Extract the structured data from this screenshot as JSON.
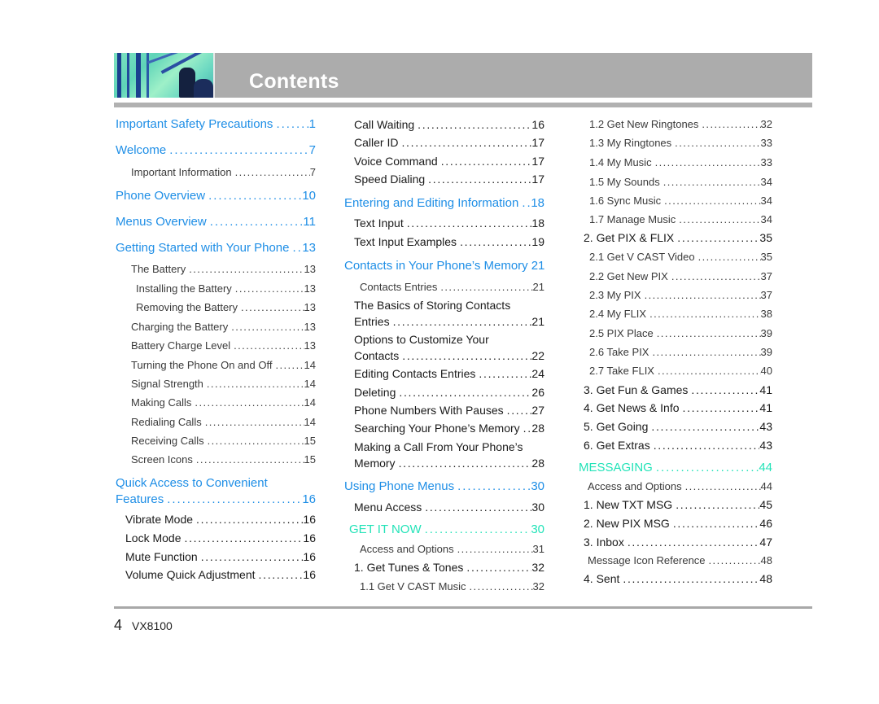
{
  "header": {
    "title": "Contents",
    "image_icon": "header-photo"
  },
  "colors": {
    "section": "#1e8ee6",
    "teal": "#23e3b8",
    "main": "#1a1a1a",
    "sub": "#3a3a3a",
    "header_bg": "#acacac"
  },
  "col1": [
    {
      "text": "Important Safety Precautions",
      "page": "1",
      "level": "section"
    },
    {
      "text": "Welcome",
      "page": "7",
      "level": "section"
    },
    {
      "text": "Important Information",
      "page": "7",
      "level": "sub"
    },
    {
      "text": "Phone Overview",
      "page": "10",
      "level": "section"
    },
    {
      "text": "Menus Overview",
      "page": "11",
      "level": "section"
    },
    {
      "text": "Getting Started with Your Phone",
      "page": "13",
      "level": "section"
    },
    {
      "text": "The Battery",
      "page": "13",
      "level": "sub"
    },
    {
      "text": "Installing the Battery",
      "page": "13",
      "level": "sub"
    },
    {
      "text": "Removing the Battery",
      "page": "13",
      "level": "sub"
    },
    {
      "text": "Charging the Battery",
      "page": "13",
      "level": "sub"
    },
    {
      "text": "Battery Charge Level",
      "page": "13",
      "level": "sub"
    },
    {
      "text": "Turning the Phone On and Off",
      "page": "14",
      "level": "sub"
    },
    {
      "text": "Signal Strength",
      "page": "14",
      "level": "sub"
    },
    {
      "text": "Making Calls",
      "page": "14",
      "level": "sub"
    },
    {
      "text": "Redialing Calls",
      "page": "14",
      "level": "sub"
    },
    {
      "text": "Receiving Calls",
      "page": "15",
      "level": "sub"
    },
    {
      "text": "Screen Icons",
      "page": "15",
      "level": "sub"
    },
    {
      "text_line1": "Quick Access to Convenient",
      "text": "Features",
      "page": "16",
      "level": "section"
    },
    {
      "text": "Vibrate Mode",
      "page": "16",
      "level": "main"
    },
    {
      "text": "Lock Mode",
      "page": "16",
      "level": "main"
    },
    {
      "text": "Mute Function",
      "page": "16",
      "level": "main"
    },
    {
      "text": "Volume Quick Adjustment",
      "page": "16",
      "level": "main"
    }
  ],
  "col2": [
    {
      "text": "Call Waiting",
      "page": "16",
      "level": "main"
    },
    {
      "text": "Caller ID",
      "page": "17",
      "level": "main"
    },
    {
      "text": "Voice Command",
      "page": "17",
      "level": "main"
    },
    {
      "text": "Speed Dialing",
      "page": "17",
      "level": "main"
    },
    {
      "text": "Entering and Editing Information",
      "page": "18",
      "level": "section"
    },
    {
      "text": "Text Input",
      "page": "18",
      "level": "main"
    },
    {
      "text": "Text Input Examples",
      "page": "19",
      "level": "main"
    },
    {
      "text": "Contacts in Your Phone’s Memory",
      "page": "21",
      "level": "section"
    },
    {
      "text": "Contacts Entries",
      "page": "21",
      "level": "sub"
    },
    {
      "text_line1": "The Basics of Storing Contacts",
      "text": "Entries",
      "page": "21",
      "level": "main"
    },
    {
      "text_line1": "Options to Customize Your",
      "text": "Contacts",
      "page": "22",
      "level": "main"
    },
    {
      "text": "Editing Contacts Entries",
      "page": "24",
      "level": "main"
    },
    {
      "text": "Deleting",
      "page": "26",
      "level": "main"
    },
    {
      "text": "Phone Numbers With Pauses",
      "page": "27",
      "level": "main"
    },
    {
      "text": "Searching Your Phone’s Memory",
      "page": "28",
      "level": "main"
    },
    {
      "text_line1": "Making a Call From Your Phone’s",
      "text": "Memory",
      "page": "28",
      "level": "main"
    },
    {
      "text": "Using Phone Menus",
      "page": "30",
      "level": "section"
    },
    {
      "text": "Menu Access",
      "page": "30",
      "level": "main"
    },
    {
      "text": "GET IT NOW",
      "page": "30",
      "level": "teal"
    },
    {
      "text": "Access and Options",
      "page": "31",
      "level": "sub"
    },
    {
      "text": "1. Get Tunes & Tones",
      "page": "32",
      "level": "main"
    },
    {
      "text": "1.1 Get V CAST Music",
      "page": "32",
      "level": "sub"
    }
  ],
  "col3": [
    {
      "text": "1.2 Get New Ringtones",
      "page": "32",
      "level": "sub"
    },
    {
      "text": "1.3 My Ringtones",
      "page": "33",
      "level": "sub"
    },
    {
      "text": "1.4 My Music",
      "page": "33",
      "level": "sub"
    },
    {
      "text": "1.5 My Sounds",
      "page": "34",
      "level": "sub"
    },
    {
      "text": "1.6 Sync Music",
      "page": "34",
      "level": "sub"
    },
    {
      "text": "1.7 Manage Music",
      "page": "34",
      "level": "sub"
    },
    {
      "text": "2. Get PIX & FLIX",
      "page": "35",
      "level": "main"
    },
    {
      "text": "2.1 Get V CAST Video",
      "page": "35",
      "level": "sub"
    },
    {
      "text": "2.2 Get New PIX",
      "page": "37",
      "level": "sub"
    },
    {
      "text": "2.3 My PIX",
      "page": "37",
      "level": "sub"
    },
    {
      "text": "2.4 My FLIX",
      "page": "38",
      "level": "sub"
    },
    {
      "text": "2.5 PIX Place",
      "page": "39",
      "level": "sub"
    },
    {
      "text": "2.6 Take PIX",
      "page": "39",
      "level": "sub"
    },
    {
      "text": "2.7 Take FLIX",
      "page": "40",
      "level": "sub"
    },
    {
      "text": "3. Get Fun & Games",
      "page": "41",
      "level": "main"
    },
    {
      "text": "4. Get News & Info",
      "page": "41",
      "level": "main"
    },
    {
      "text": "5. Get Going",
      "page": "43",
      "level": "main"
    },
    {
      "text": "6. Get Extras",
      "page": "43",
      "level": "main"
    },
    {
      "text": "MESSAGING",
      "page": "44",
      "level": "teal"
    },
    {
      "text": "Access and Options",
      "page": "44",
      "level": "sub"
    },
    {
      "text": "1. New TXT MSG",
      "page": "45",
      "level": "main"
    },
    {
      "text": "2. New PIX MSG",
      "page": "46",
      "level": "main"
    },
    {
      "text": "3. Inbox",
      "page": "47",
      "level": "main"
    },
    {
      "text": "Message Icon Reference",
      "page": "48",
      "level": "sub"
    },
    {
      "text": "4. Sent",
      "page": "48",
      "level": "main"
    }
  ],
  "footer": {
    "page_number": "4",
    "model": "VX8100"
  }
}
